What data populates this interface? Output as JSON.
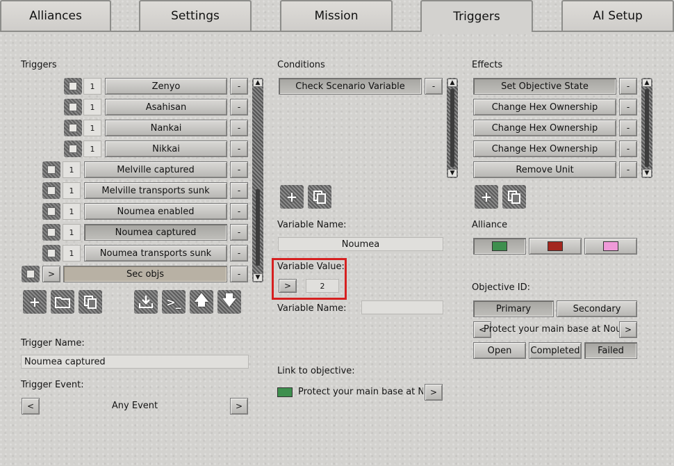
{
  "tabs": [
    "Alliances",
    "Settings",
    "Mission",
    "Triggers",
    "AI Setup"
  ],
  "triggers": {
    "section_label": "Triggers",
    "items": [
      {
        "num": "1",
        "label": "Zenyo"
      },
      {
        "num": "1",
        "label": "Asahisan"
      },
      {
        "num": "1",
        "label": "Nankai"
      },
      {
        "num": "1",
        "label": "Nikkai"
      },
      {
        "num": "1",
        "label": "Melville captured"
      },
      {
        "num": "1",
        "label": "Melville transports sunk"
      },
      {
        "num": "1",
        "label": "Noumea enabled"
      },
      {
        "num": "1",
        "label": "Noumea captured"
      },
      {
        "num": "1",
        "label": "Noumea transports sunk"
      },
      {
        "num": ">",
        "label": "Sec objs"
      }
    ],
    "remove_label": "-",
    "name_label": "Trigger Name:",
    "name_value": "Noumea captured",
    "event_label": "Trigger Event:",
    "event_value": "Any Event",
    "prev_label": "<",
    "next_label": ">"
  },
  "conditions": {
    "section_label": "Conditions",
    "items": [
      {
        "label": "Check Scenario Variable"
      }
    ],
    "remove_label": "-",
    "variable_name_label": "Variable Name:",
    "variable_name_value": "Noumea",
    "variable_value_label": "Variable Value:",
    "variable_value_op": ">",
    "variable_value": "2",
    "variable_name2_label": "Variable Name:",
    "variable_name2_value": "",
    "link_label": "Link to objective:",
    "link_value": "Protect your main base at Noumea",
    "link_next": ">"
  },
  "effects": {
    "section_label": "Effects",
    "items": [
      {
        "label": "Set Objective State"
      },
      {
        "label": "Change Hex Ownership"
      },
      {
        "label": "Change Hex Ownership"
      },
      {
        "label": "Change Hex Ownership"
      },
      {
        "label": "Remove Unit"
      }
    ],
    "remove_label": "-",
    "alliance_label": "Alliance",
    "alliance_colors": [
      "#3e8f4e",
      "#a3271f",
      "#ef9ad8"
    ],
    "objective_id_label": "Objective ID:",
    "objective_types": [
      "Primary",
      "Secondary"
    ],
    "objective_value": "Protect your main base at Noumea",
    "prev_label": "<",
    "next_label": ">",
    "states": [
      "Open",
      "Completed",
      "Failed"
    ]
  },
  "icons": [
    "plus-icon",
    "folder-icon",
    "copy-icon",
    "import-icon",
    "console-icon",
    "arrow-up-icon",
    "arrow-down-icon"
  ],
  "colors": {
    "highlight": "#d62020",
    "selected_row": "#b8b1a4",
    "link_swatch": "#3e8f4e"
  }
}
